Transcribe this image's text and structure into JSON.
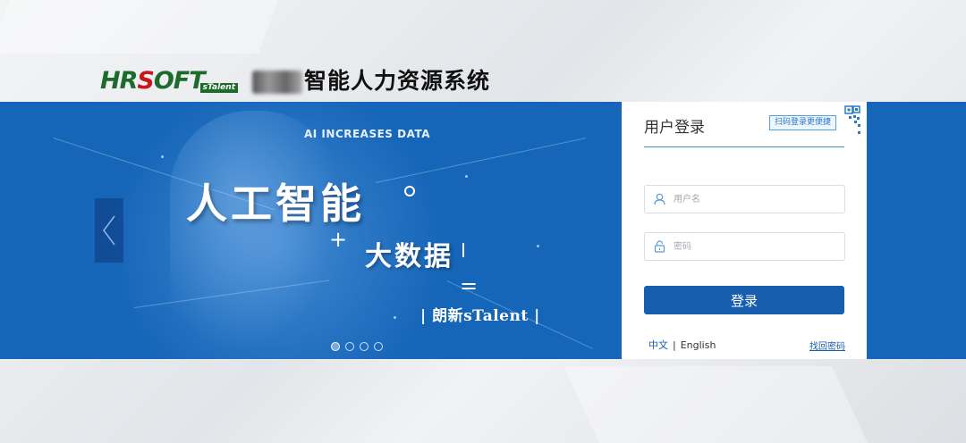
{
  "header": {
    "logo_text_main": "HRSOFT",
    "logo_text_sub": "sTalent",
    "system_title": "智能人力资源系统"
  },
  "banner": {
    "tagline_en": "AI INCREASES DATA",
    "slogan_ai": "人工智能",
    "plus": "+",
    "slogan_bigdata": "大数据",
    "equals": "=",
    "slogan_brand": "| 朗新sTalent |",
    "slide_count": 4,
    "active_slide": 1
  },
  "login": {
    "title": "用户登录",
    "scan_tip": "扫码登录更便捷",
    "username_placeholder": "用户名",
    "password_placeholder": "密码",
    "submit_label": "登录",
    "lang_zh": "中文",
    "lang_sep": "|",
    "lang_en": "English",
    "forgot_password": "找回密码"
  },
  "icons": {
    "user": "user-icon",
    "lock": "lock-icon",
    "qr": "qr-code-icon",
    "prev": "chevron-left-icon"
  },
  "colors": {
    "banner_blue": "#1565b8",
    "button_blue": "#175fae",
    "logo_green": "#1d6b2a",
    "logo_red": "#c8161d"
  }
}
